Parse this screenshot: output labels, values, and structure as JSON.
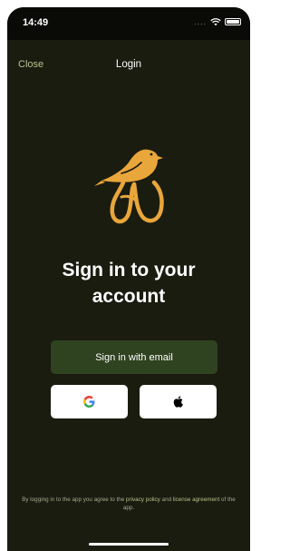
{
  "status_bar": {
    "time": "14:49",
    "signal": "....",
    "wifi_icon": "wifi-icon",
    "battery_icon": "battery-icon"
  },
  "nav": {
    "close_label": "Close",
    "title": "Login"
  },
  "logo": {
    "icon": "bird-logo-icon",
    "color": "#e9a63b"
  },
  "headline": {
    "line1": "Sign in to your",
    "line2": "account"
  },
  "buttons": {
    "email_label": "Sign in with email",
    "google_icon": "google-icon",
    "apple_icon": "apple-icon"
  },
  "disclaimer": {
    "prefix": "By logging in to the app you agree to the ",
    "privacy_link": "privacy policy",
    "middle": " and ",
    "license_link": "license agreement",
    "suffix": " of the app."
  },
  "colors": {
    "background": "#1a1c10",
    "accent": "#b7c28a",
    "primary_button": "#304321"
  }
}
